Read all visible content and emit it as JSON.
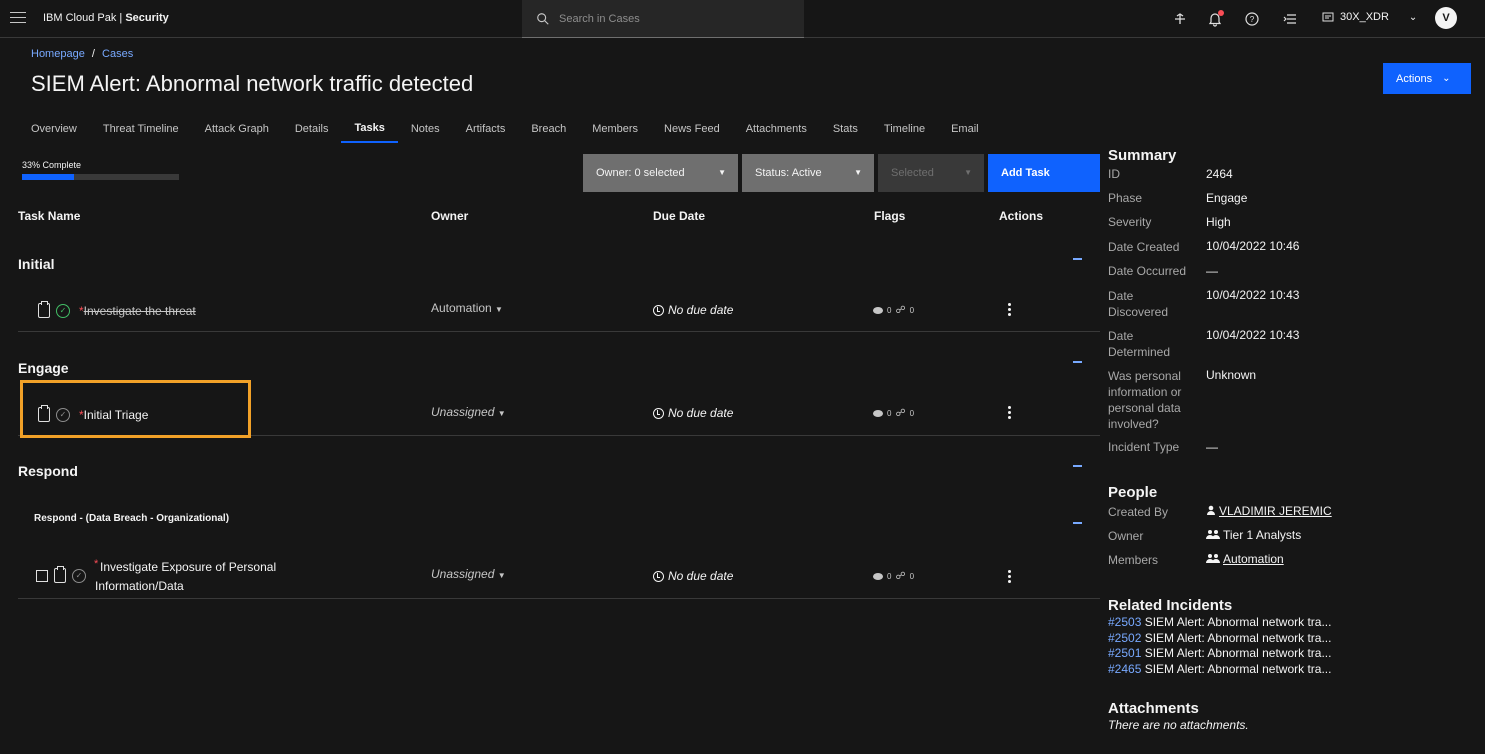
{
  "header": {
    "brand_prefix": "IBM Cloud Pak | ",
    "brand_bold": "Security",
    "search_placeholder": "Search in Cases",
    "tenant": "30X_XDR",
    "avatar_initial": "V"
  },
  "breadcrumb": {
    "home": "Homepage",
    "sep": "/",
    "cases": "Cases"
  },
  "page_title": "SIEM Alert: Abnormal network traffic detected",
  "actions_label": "Actions",
  "tabs": [
    "Overview",
    "Threat Timeline",
    "Attack Graph",
    "Details",
    "Tasks",
    "Notes",
    "Artifacts",
    "Breach",
    "Members",
    "News Feed",
    "Attachments",
    "Stats",
    "Timeline",
    "Email"
  ],
  "active_tab": "Tasks",
  "progress": {
    "label": "33% Complete",
    "percent": 33
  },
  "filters": {
    "owner": "Owner: 0 selected",
    "status": "Status: Active",
    "selected": "Selected",
    "add_task": "Add Task"
  },
  "columns": {
    "task_name": "Task Name",
    "owner": "Owner",
    "due_date": "Due Date",
    "flags": "Flags",
    "actions": "Actions"
  },
  "groups": {
    "initial": {
      "title": "Initial",
      "task": {
        "required": "*",
        "name": "Investigate the threat",
        "owner": "Automation",
        "due": "No due date",
        "comments": "0",
        "attachments": "0",
        "completed": true
      }
    },
    "engage": {
      "title": "Engage",
      "task": {
        "required": "*",
        "name": "Initial Triage",
        "owner": "Unassigned",
        "due": "No due date",
        "comments": "0",
        "attachments": "0",
        "completed": false
      }
    },
    "respond": {
      "title": "Respond",
      "subgroup": "Respond - (Data Breach - Organizational)",
      "task": {
        "required": "*",
        "name_line1": "Investigate Exposure of Personal",
        "name_line2": "Information/Data",
        "owner": "Unassigned",
        "due": "No due date",
        "comments": "0",
        "attachments": "0",
        "completed": false
      }
    }
  },
  "summary": {
    "title": "Summary",
    "fields": {
      "id": {
        "key": "ID",
        "value": "2464"
      },
      "phase": {
        "key": "Phase",
        "value": "Engage"
      },
      "severity": {
        "key": "Severity",
        "value": "High"
      },
      "date_created": {
        "key": "Date Created",
        "value": "10/04/2022 10:46"
      },
      "date_occurred": {
        "key": "Date Occurred",
        "value": "—"
      },
      "date_discovered": {
        "key_line1": "Date",
        "key_line2": "Discovered",
        "value": "10/04/2022 10:43"
      },
      "date_determined": {
        "key_line1": "Date",
        "key_line2": "Determined",
        "value": "10/04/2022 10:43"
      },
      "personal_info": {
        "key_line1": "Was personal",
        "key_line2": "information or",
        "key_line3": "personal data",
        "key_line4": "involved?",
        "value": "Unknown"
      },
      "incident_type": {
        "key": "Incident Type",
        "value": "—"
      }
    }
  },
  "people": {
    "title": "People",
    "created_by": {
      "key": "Created By",
      "value": "VLADIMIR JEREMIC"
    },
    "owner": {
      "key": "Owner",
      "value": "Tier 1 Analysts"
    },
    "members": {
      "key": "Members",
      "value": "Automation"
    }
  },
  "related": {
    "title": "Related Incidents",
    "items": [
      {
        "num": "#2503",
        "text": " SIEM Alert: Abnormal network tra..."
      },
      {
        "num": "#2502",
        "text": " SIEM Alert: Abnormal network tra..."
      },
      {
        "num": "#2501",
        "text": " SIEM Alert: Abnormal network tra..."
      },
      {
        "num": "#2465",
        "text": " SIEM Alert: Abnormal network tra..."
      }
    ]
  },
  "attachments": {
    "title": "Attachments",
    "empty": "There are no attachments."
  },
  "colors": {
    "accent": "#0f62fe",
    "link": "#78a9ff",
    "required": "#fa4d56",
    "done": "#42be65",
    "highlight": "#f1a128"
  }
}
